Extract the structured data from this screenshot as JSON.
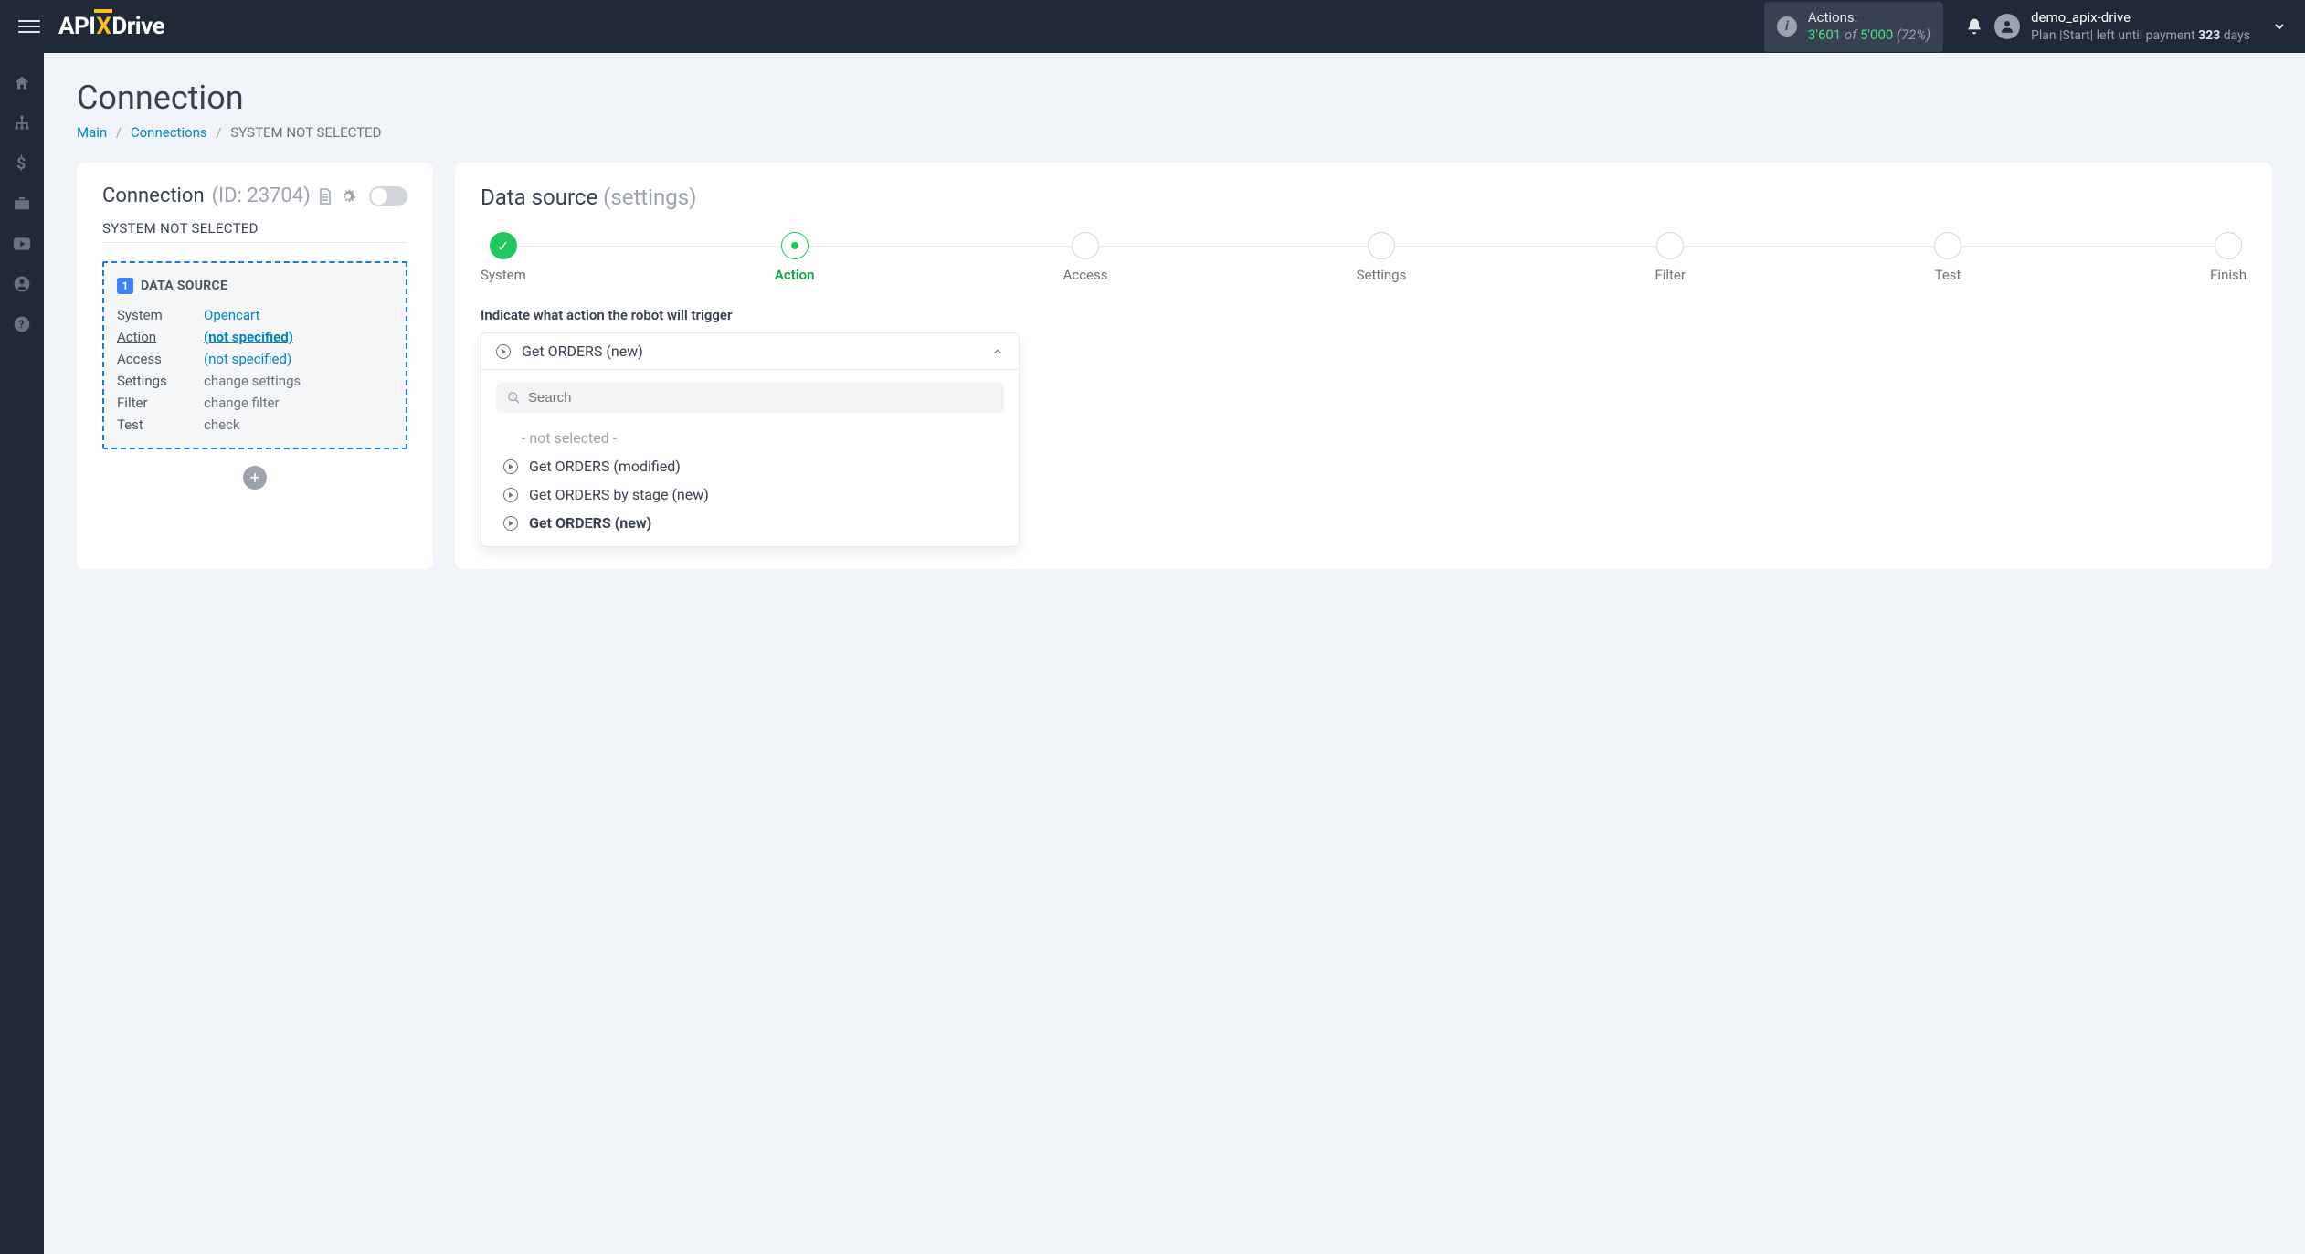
{
  "header": {
    "logo_api": "API",
    "logo_x": "X",
    "logo_drive": "Drive",
    "actions_label": "Actions:",
    "actions_current": "3'601",
    "actions_of": " of ",
    "actions_max": "5'000",
    "actions_pct": " (72%)",
    "username": "demo_apix-drive",
    "plan_prefix": "Plan |Start| left until payment ",
    "plan_days": "323",
    "plan_suffix": " days"
  },
  "page": {
    "title": "Connection",
    "breadcrumbs": {
      "main": "Main",
      "connections": "Connections",
      "current": "SYSTEM NOT SELECTED"
    }
  },
  "conn_panel": {
    "title": "Connection",
    "id": "(ID: 23704)",
    "subtitle": "SYSTEM NOT SELECTED",
    "source_num": "1",
    "source_title": "DATA SOURCE",
    "rows": {
      "system_label": "System",
      "system_value": "Opencart",
      "action_label": "Action",
      "action_value": "(not specified)",
      "access_label": "Access",
      "access_value": "(not specified)",
      "settings_label": "Settings",
      "settings_value": "change settings",
      "filter_label": "Filter",
      "filter_value": "change filter",
      "test_label": "Test",
      "test_value": "check"
    }
  },
  "right_panel": {
    "title_main": "Data source",
    "title_soft": "(settings)",
    "steps": {
      "system": "System",
      "action": "Action",
      "access": "Access",
      "settings": "Settings",
      "filter": "Filter",
      "test": "Test",
      "finish": "Finish"
    },
    "section_label": "Indicate what action the robot will trigger",
    "selected": "Get ORDERS (new)",
    "search_placeholder": "Search",
    "options": {
      "not_selected": "- not selected -",
      "opt1": "Get ORDERS (modified)",
      "opt2": "Get ORDERS by stage (new)",
      "opt3": "Get ORDERS (new)"
    }
  }
}
